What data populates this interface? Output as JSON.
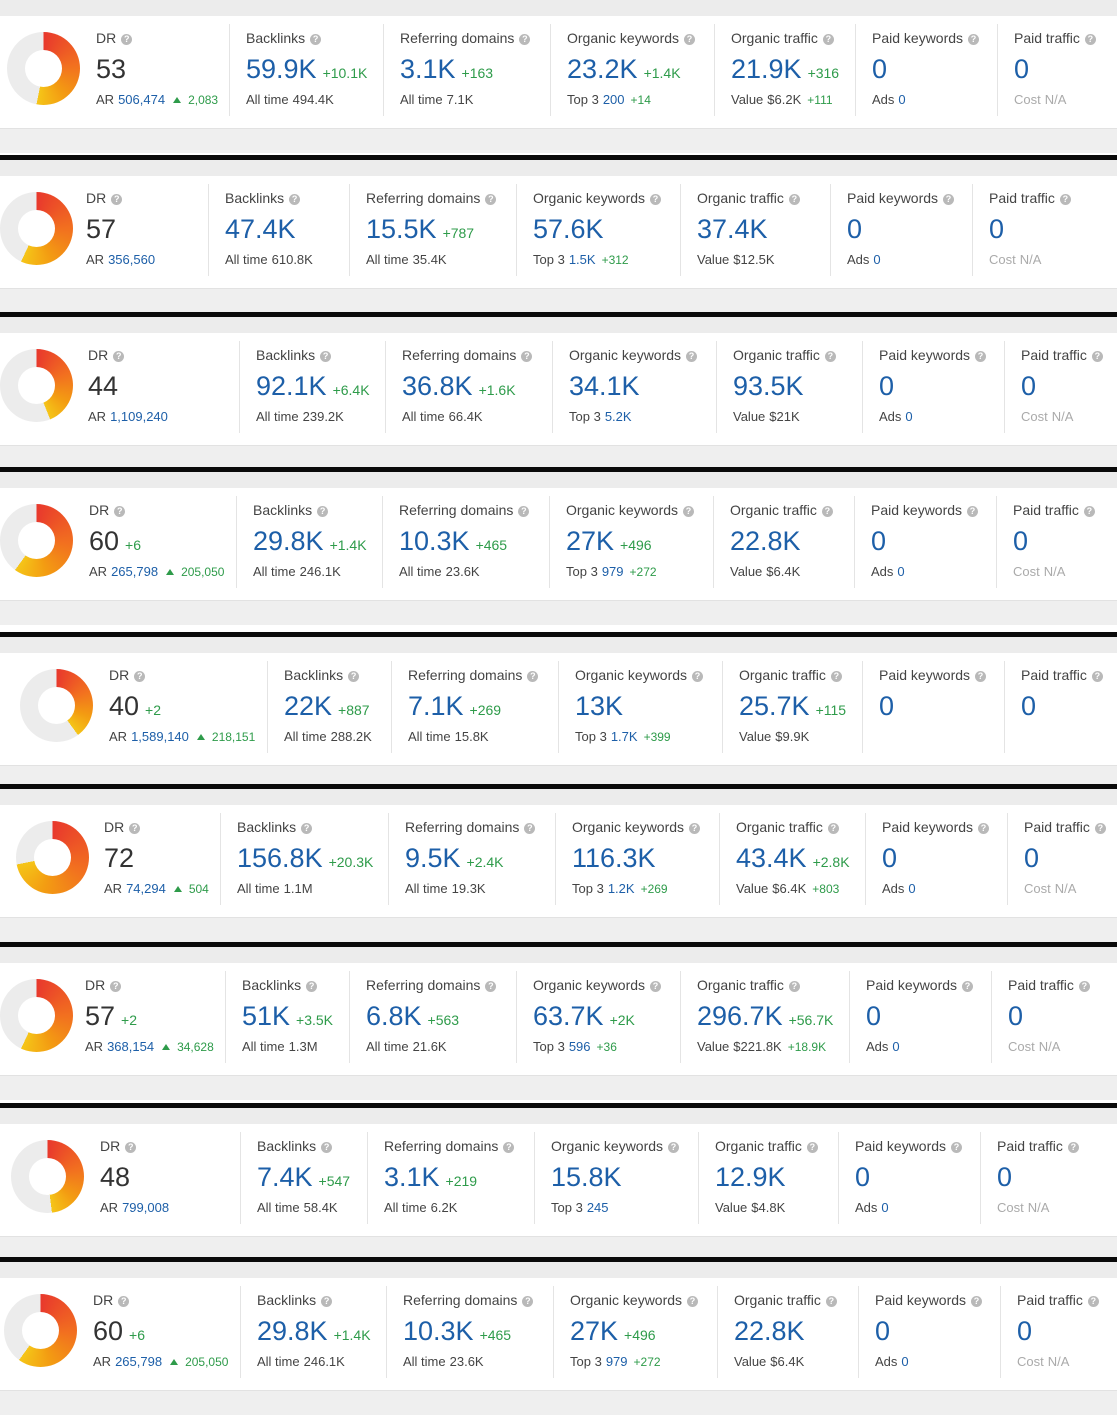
{
  "labels": {
    "dr": "DR",
    "backlinks": "Backlinks",
    "ref_domains": "Referring domains",
    "org_keywords": "Organic keywords",
    "org_traffic": "Organic traffic",
    "paid_keywords": "Paid keywords",
    "paid_traffic": "Paid traffic",
    "ar": "AR",
    "all_time": "All time",
    "top3": "Top 3",
    "value": "Value",
    "ads": "Ads",
    "cost": "Cost",
    "help_glyph": "?"
  },
  "colors": {
    "accent": "#1d5fa8",
    "positive": "#2e9b4a",
    "muted": "#aaaaaa",
    "donut_track": "#ececec"
  },
  "panels": [
    {
      "dr": "53",
      "dr_delta": "",
      "dr_fill": 0.53,
      "ar": "506,474",
      "ar_delta": "2,083",
      "bl": "59.9K",
      "bl_delta": "+10.1K",
      "bl_all": "494.4K",
      "rd": "3.1K",
      "rd_delta": "+163",
      "rd_all": "7.1K",
      "ok": "23.2K",
      "ok_delta": "+1.4K",
      "ok_top3": "200",
      "ok_top3_delta": "+14",
      "ot": "21.9K",
      "ot_delta": "+316",
      "ot_value": "$6.2K",
      "ot_value_delta": "+111",
      "pk": "0",
      "pk_ads": "0",
      "pt": "0",
      "pt_cost": "N/A"
    },
    {
      "dr": "57",
      "dr_delta": "",
      "dr_fill": 0.57,
      "ar": "356,560",
      "ar_delta": "",
      "bl": "47.4K",
      "bl_delta": "",
      "bl_all": "610.8K",
      "rd": "15.5K",
      "rd_delta": "+787",
      "rd_all": "35.4K",
      "ok": "57.6K",
      "ok_delta": "",
      "ok_top3": "1.5K",
      "ok_top3_delta": "+312",
      "ot": "37.4K",
      "ot_delta": "",
      "ot_value": "$12.5K",
      "ot_value_delta": "",
      "pk": "0",
      "pk_ads": "0",
      "pt": "0",
      "pt_cost": "N/A"
    },
    {
      "dr": "44",
      "dr_delta": "",
      "dr_fill": 0.44,
      "ar": "1,109,240",
      "ar_delta": "",
      "bl": "92.1K",
      "bl_delta": "+6.4K",
      "bl_all": "239.2K",
      "rd": "36.8K",
      "rd_delta": "+1.6K",
      "rd_all": "66.4K",
      "ok": "34.1K",
      "ok_delta": "",
      "ok_top3": "5.2K",
      "ok_top3_delta": "",
      "ot": "93.5K",
      "ot_delta": "",
      "ot_value": "$21K",
      "ot_value_delta": "",
      "pk": "0",
      "pk_ads": "0",
      "pt": "0",
      "pt_cost": "N/A"
    },
    {
      "dr": "60",
      "dr_delta": "+6",
      "dr_fill": 0.6,
      "ar": "265,798",
      "ar_delta": "205,050",
      "bl": "29.8K",
      "bl_delta": "+1.4K",
      "bl_all": "246.1K",
      "rd": "10.3K",
      "rd_delta": "+465",
      "rd_all": "23.6K",
      "ok": "27K",
      "ok_delta": "+496",
      "ok_top3": "979",
      "ok_top3_delta": "+272",
      "ot": "22.8K",
      "ot_delta": "",
      "ot_value": "$6.4K",
      "ot_value_delta": "",
      "pk": "0",
      "pk_ads": "0",
      "pt": "0",
      "pt_cost": "N/A"
    },
    {
      "dr": "40",
      "dr_delta": "+2",
      "dr_fill": 0.4,
      "ar": "1,589,140",
      "ar_delta": "218,151",
      "bl": "22K",
      "bl_delta": "+887",
      "bl_all": "288.2K",
      "rd": "7.1K",
      "rd_delta": "+269",
      "rd_all": "15.8K",
      "ok": "13K",
      "ok_delta": "",
      "ok_top3": "1.7K",
      "ok_top3_delta": "+399",
      "ot": "25.7K",
      "ot_delta": "+115",
      "ot_value": "$9.9K",
      "ot_value_delta": "",
      "pk": "0",
      "pk_ads": "",
      "pt": "0",
      "pt_cost": ""
    },
    {
      "dr": "72",
      "dr_delta": "",
      "dr_fill": 0.72,
      "ar": "74,294",
      "ar_delta": "504",
      "bl": "156.8K",
      "bl_delta": "+20.3K",
      "bl_all": "1.1M",
      "rd": "9.5K",
      "rd_delta": "+2.4K",
      "rd_all": "19.3K",
      "ok": "116.3K",
      "ok_delta": "",
      "ok_top3": "1.2K",
      "ok_top3_delta": "+269",
      "ot": "43.4K",
      "ot_delta": "+2.8K",
      "ot_value": "$6.4K",
      "ot_value_delta": "+803",
      "pk": "0",
      "pk_ads": "0",
      "pt": "0",
      "pt_cost": "N/A"
    },
    {
      "dr": "57",
      "dr_delta": "+2",
      "dr_fill": 0.57,
      "ar": "368,154",
      "ar_delta": "34,628",
      "bl": "51K",
      "bl_delta": "+3.5K",
      "bl_all": "1.3M",
      "rd": "6.8K",
      "rd_delta": "+563",
      "rd_all": "21.6K",
      "ok": "63.7K",
      "ok_delta": "+2K",
      "ok_top3": "596",
      "ok_top3_delta": "+36",
      "ot": "296.7K",
      "ot_delta": "+56.7K",
      "ot_value": "$221.8K",
      "ot_value_delta": "+18.9K",
      "pk": "0",
      "pk_ads": "0",
      "pt": "0",
      "pt_cost": "N/A"
    },
    {
      "dr": "48",
      "dr_delta": "",
      "dr_fill": 0.48,
      "ar": "799,008",
      "ar_delta": "",
      "bl": "7.4K",
      "bl_delta": "+547",
      "bl_all": "58.4K",
      "rd": "3.1K",
      "rd_delta": "+219",
      "rd_all": "6.2K",
      "ok": "15.8K",
      "ok_delta": "",
      "ok_top3": "245",
      "ok_top3_delta": "",
      "ot": "12.9K",
      "ot_delta": "",
      "ot_value": "$4.8K",
      "ot_value_delta": "",
      "pk": "0",
      "pk_ads": "0",
      "pt": "0",
      "pt_cost": "N/A"
    },
    {
      "dr": "60",
      "dr_delta": "+6",
      "dr_fill": 0.6,
      "ar": "265,798",
      "ar_delta": "205,050",
      "bl": "29.8K",
      "bl_delta": "+1.4K",
      "bl_all": "246.1K",
      "rd": "10.3K",
      "rd_delta": "+465",
      "rd_all": "23.6K",
      "ok": "27K",
      "ok_delta": "+496",
      "ok_top3": "979",
      "ok_top3_delta": "+272",
      "ot": "22.8K",
      "ot_delta": "",
      "ot_value": "$6.4K",
      "ot_value_delta": "",
      "pk": "0",
      "pk_ads": "0",
      "pt": "0",
      "pt_cost": "N/A"
    }
  ]
}
